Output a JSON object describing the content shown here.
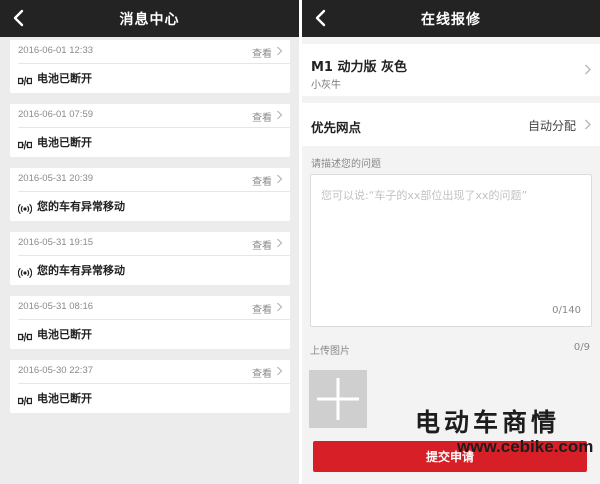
{
  "left_screen": {
    "header": {
      "title": "消息中心",
      "back_icon": "chevron-left-icon"
    },
    "view_label": "查看",
    "messages": [
      {
        "time": "2016-06-01 12:33",
        "text": "电池已断开",
        "icon": "battery-disconnected-icon"
      },
      {
        "time": "2016-06-01 07:59",
        "text": "电池已断开",
        "icon": "battery-disconnected-icon"
      },
      {
        "time": "2016-05-31 20:39",
        "text": "您的车有异常移动",
        "icon": "alarm-signal-icon"
      },
      {
        "time": "2016-05-31 19:15",
        "text": "您的车有异常移动",
        "icon": "alarm-signal-icon"
      },
      {
        "time": "2016-05-31 08:16",
        "text": "电池已断开",
        "icon": "battery-disconnected-icon"
      },
      {
        "time": "2016-05-30 22:37",
        "text": "电池已断开",
        "icon": "battery-disconnected-icon"
      }
    ]
  },
  "right_screen": {
    "header": {
      "title": "在线报修",
      "back_icon": "chevron-left-icon"
    },
    "vehicle": {
      "model": "M1 动力版 灰色",
      "nickname": "小灰牛"
    },
    "preferred_outlet": {
      "label": "优先网点",
      "value": "自动分配"
    },
    "description": {
      "label": "请描述您的问题",
      "placeholder": "您可以说:“车子的xx部位出现了xx的问题”",
      "counter": "0/140"
    },
    "upload": {
      "label": "上传图片",
      "counter": "0/9",
      "icon": "plus-icon"
    },
    "submit_label": "提交申请"
  },
  "watermark": {
    "text_cn": "电动车商情",
    "url": "www.cebike.com"
  },
  "colors": {
    "navbar": "#232323",
    "accent": "#d61f26",
    "left_bg": "#ececec",
    "right_bg": "#f3f3f3"
  }
}
